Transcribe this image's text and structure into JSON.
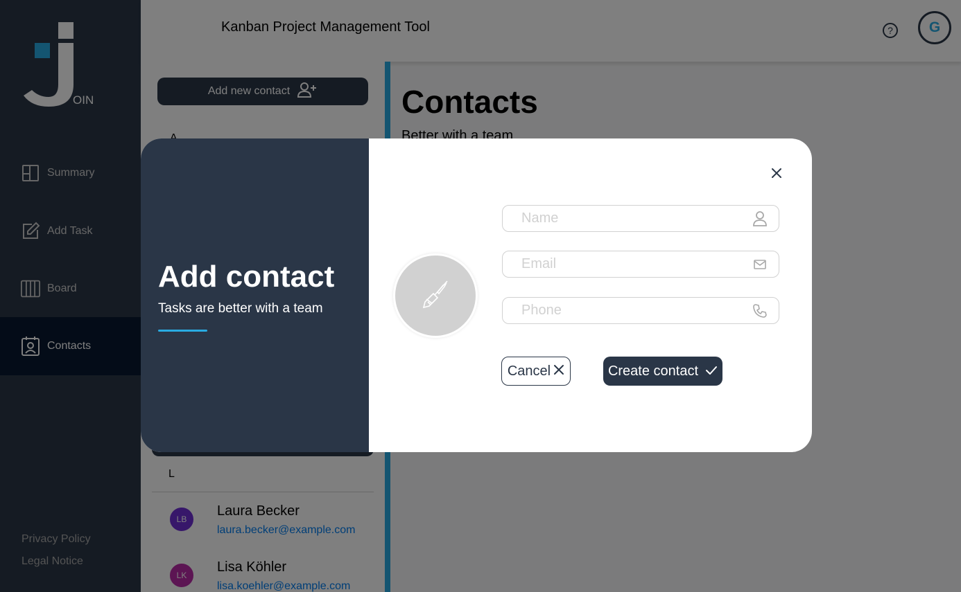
{
  "app": {
    "header_title": "Kanban Project Management Tool",
    "user_initial": "G",
    "logo_text": "OIN"
  },
  "sidebar": {
    "items": [
      {
        "label": "Summary",
        "icon": "summary-icon"
      },
      {
        "label": "Add Task",
        "icon": "edit-icon"
      },
      {
        "label": "Board",
        "icon": "board-icon"
      },
      {
        "label": "Contacts",
        "icon": "contacts-icon",
        "active": true
      }
    ],
    "footer": {
      "privacy": "Privacy Policy",
      "legal": "Legal Notice"
    }
  },
  "contact_list": {
    "add_button_label": "Add new contact",
    "letters": [
      "A",
      "L"
    ],
    "contacts": [
      {
        "initials": "LB",
        "name": "Laura Becker",
        "email": "laura.becker@example.com",
        "color": "#6e2fd4"
      },
      {
        "initials": "LK",
        "name": "Lisa Köhler",
        "email": "lisa.koehler@example.com",
        "color": "#b82aa7"
      }
    ]
  },
  "main": {
    "title": "Contacts",
    "subtitle": "Better with a team"
  },
  "modal": {
    "title": "Add contact",
    "subtitle": "Tasks are better with a team",
    "fields": {
      "name_placeholder": "Name",
      "email_placeholder": "Email",
      "phone_placeholder": "Phone"
    },
    "cancel_label": "Cancel",
    "create_label": "Create contact"
  },
  "colors": {
    "sidebar_bg": "#2a3647",
    "sidebar_active": "#091931",
    "accent": "#29abe2",
    "link": "#007cee"
  }
}
